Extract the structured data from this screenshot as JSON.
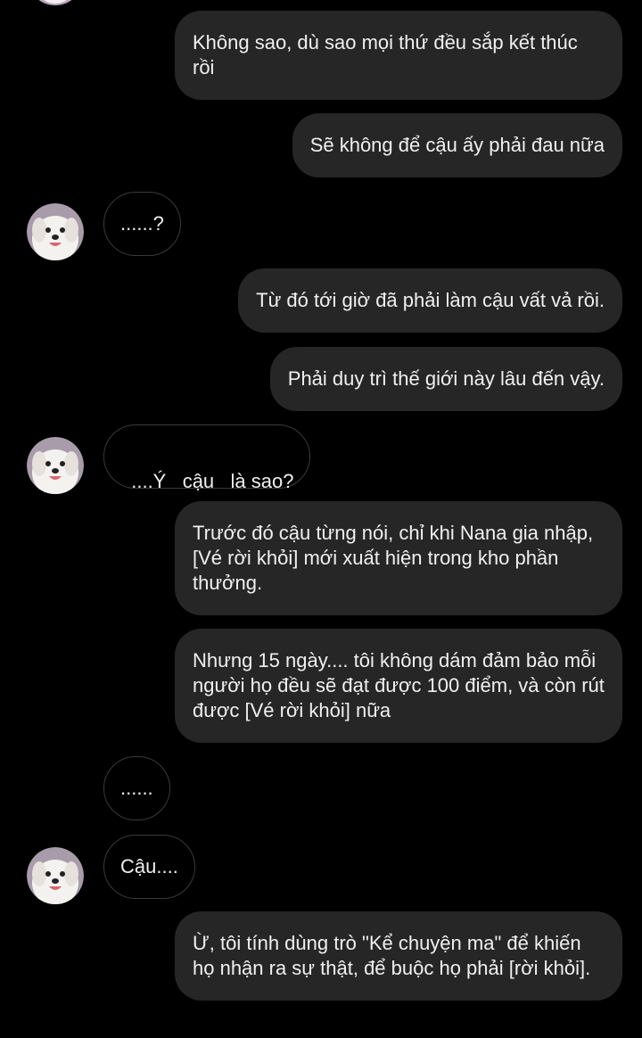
{
  "messages": [
    {
      "from": "me",
      "text": "Không sao, dù sao mọi thứ đều sắp kết thúc rồi"
    },
    {
      "from": "me",
      "text": "Sẽ không để cậu ấy phải đau nữa"
    },
    {
      "from": "other",
      "text": "......?"
    },
    {
      "from": "me",
      "text": "Từ đó tới giờ đã phải làm cậu vất vả rồi."
    },
    {
      "from": "me",
      "text": "Phải duy trì thế giới này lâu đến vậy."
    },
    {
      "from": "other",
      "text": "....Ý   cậu   là sao?"
    },
    {
      "from": "me",
      "text": "Trước đó cậu từng nói, chỉ khi Nana gia nhập, [Vé rời khỏi] mới xuất hiện trong kho phần thưởng."
    },
    {
      "from": "me",
      "text": "Nhưng 15 ngày.... tôi không dám đảm bảo mỗi người họ đều sẽ đạt được 100 điểm, và còn rút được [Vé rời khỏi] nữa"
    },
    {
      "from": "other",
      "text": "......"
    },
    {
      "from": "other",
      "text": "Cậu...."
    },
    {
      "from": "me",
      "text": "Ừ, tôi tính dùng trò \"Kể chuyện ma\" để khiến họ nhận ra sự thật, để buộc họ phải [rời khỏi]."
    }
  ],
  "avatar_icon": "dog-avatar-icon",
  "colors": {
    "background": "#000000",
    "outgoing_bubble": "#262626",
    "incoming_border": "#3a3a3a",
    "text": "#f0f0f0"
  }
}
